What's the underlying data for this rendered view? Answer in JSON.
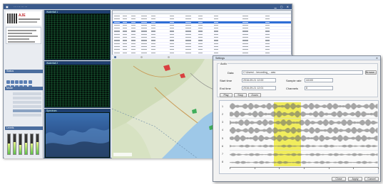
{
  "main_window": {
    "title": "··· ··· ··· ···",
    "logo_text": "AJE",
    "left_panel_headers": [
      "Status",
      "Mode",
      "Levels"
    ],
    "waterfall_panes": [
      {
        "name": "waterfall-top",
        "label": "Waterfall 1"
      },
      {
        "name": "waterfall-middle",
        "label": "Waterfall 2"
      },
      {
        "name": "spectrum-bottom",
        "label": "Spectrum"
      }
    ],
    "level_meters": [
      0.55,
      0.62,
      0.48,
      0.58,
      0.52,
      0.6
    ]
  },
  "table": {
    "rows": 14,
    "selected_row": 2
  },
  "dialog": {
    "title": "Settings",
    "tab_label": "Audio",
    "fields": {
      "file_label": "Data",
      "file_value": "C:\\Users\\...\\recording_...wav",
      "browse_label": "Browse...",
      "start_label": "Start time",
      "start_value": "2016-09-21 12:00",
      "end_label": "End time",
      "end_value": "2016-09-21 12:01",
      "sample_label": "Sample rate",
      "sample_value": "44100",
      "channels_label": "Channels",
      "channels_value": "8"
    },
    "toolbar_buttons": [
      "Play",
      "Stop",
      "Zoom"
    ],
    "channels": [
      "1",
      "2",
      "3",
      "4",
      "5",
      "6",
      "7",
      "8"
    ],
    "selection": {
      "start": 0.3,
      "end": 0.48
    },
    "footer_buttons": [
      "Close",
      "Apply",
      "Cancel"
    ]
  }
}
